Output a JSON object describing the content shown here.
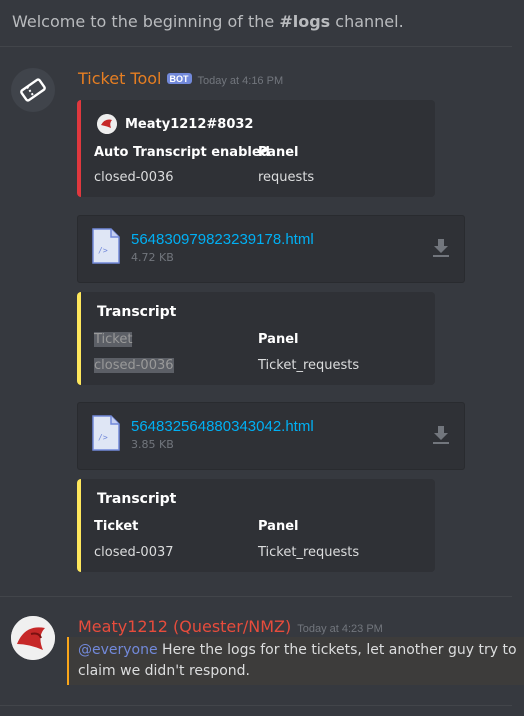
{
  "channel": {
    "welcome_prefix": "Welcome to the beginning of the ",
    "channel_name": "#logs",
    "welcome_suffix": " channel."
  },
  "messages": [
    {
      "author": "Ticket Tool",
      "author_color": "#e67e22",
      "bot_tag": "BOT",
      "timestamp": "Today at 4:16 PM",
      "embeds": [
        {
          "accent": "#e0383e",
          "author": "Meaty1212#8032",
          "fields": [
            {
              "name": "Auto Transcript enabled",
              "value": "closed-0036"
            },
            {
              "name": "Panel",
              "value": "requests"
            }
          ]
        }
      ],
      "attachments": [
        {
          "name": "564830979823239178.html",
          "size": "4.72 KB"
        },
        {
          "name": "564832564880343042.html",
          "size": "3.85 KB"
        }
      ],
      "transcripts": [
        {
          "accent": "#fee75c",
          "title": "Transcript",
          "fields": [
            {
              "name": "Ticket",
              "value": "closed-0036"
            },
            {
              "name": "Panel",
              "value": "Ticket_requests"
            }
          ]
        },
        {
          "accent": "#fee75c",
          "title": "Transcript",
          "fields": [
            {
              "name": "Ticket",
              "value": "closed-0037"
            },
            {
              "name": "Panel",
              "value": "Ticket_requests"
            }
          ]
        }
      ]
    },
    {
      "author": "Meaty1212 (Quester/NMZ)",
      "author_color": "#e74c3c",
      "timestamp": "Today at 4:23 PM",
      "mention": "@everyone",
      "content": " Here the logs for the tickets, let another guy try to claim we didn't respond."
    }
  ],
  "icons": {
    "bot_avatar": "ticket-icon",
    "file": "html-file-icon",
    "download": "download-icon"
  }
}
